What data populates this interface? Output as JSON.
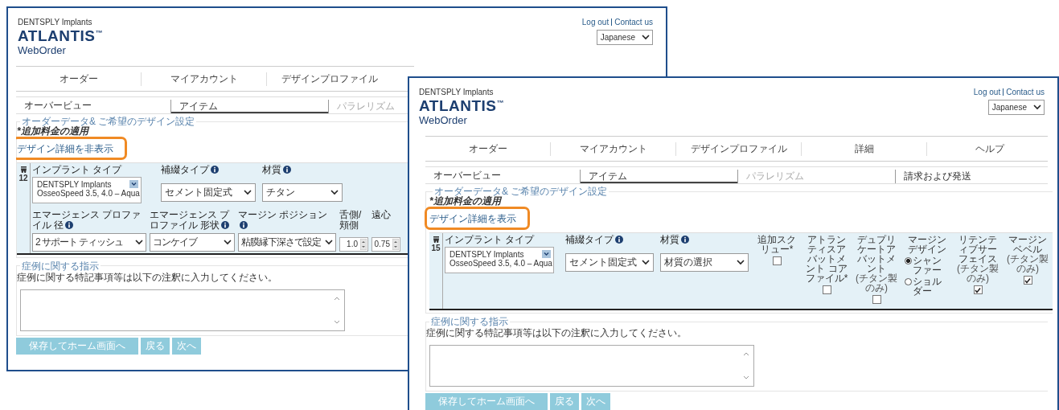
{
  "windows": [
    {
      "brand": {
        "company": "DENTSPLY Implants",
        "logo": "ATLANTIS$^{™}$",
        "product": "WebOrder"
      },
      "header_links": [
        {
          "label": "Log out"
        },
        {
          "label": "Contact us"
        }
      ],
      "language_select": {
        "value": "Japanese"
      },
      "nav": [
        {
          "label": "オーダー"
        },
        {
          "label": "マイアカウント"
        },
        {
          "label": "デザインプロファイル"
        }
      ],
      "subtabs": [
        {
          "label": "オーバービュー",
          "selected": false,
          "disabled": false
        },
        {
          "label": "アイテム",
          "selected": true,
          "disabled": false
        },
        {
          "label": "パラレリズム",
          "selected": false,
          "disabled": true
        }
      ],
      "design": {
        "legend": "オーダーデータ& ご希望のデザイン設定",
        "note": "*追加料金の適用",
        "toggle": {
          "label": "デザイン詳細を非表示",
          "highlighted": true
        },
        "tooth": "12",
        "rows": [
          {
            "fields": [
              {
                "kind": "implant",
                "label": "インプラント タイプ",
                "info": false,
                "value": [
                  "DENTSPLY Implants",
                  "OsseoSpeed 3.5, 4.0 – Aqua"
                ]
              },
              {
                "kind": "select",
                "label": "補綴タイプ",
                "info": true,
                "value": "セメント固定式"
              },
              {
                "kind": "select",
                "label": "材質",
                "info": true,
                "value": "チタン"
              }
            ]
          },
          {
            "fields": [
              {
                "kind": "select",
                "label": "エマージェンス プロファイル 径",
                "info": true,
                "value": "2 サポート ティッシュ"
              },
              {
                "kind": "select",
                "label": "エマージェンス プロファイル 形状",
                "info": true,
                "value": "コンケイブ"
              },
              {
                "kind": "select",
                "label": "マージン ポジション",
                "info": true,
                "value": "粘膜縁下深さで設定"
              },
              {
                "kind": "spinner",
                "label": "舌側/頬側",
                "info": false,
                "value": "1.0"
              },
              {
                "kind": "spinner",
                "label": "遠心",
                "info": false,
                "value": "0.75"
              }
            ]
          }
        ]
      },
      "instructions": {
        "legend": "症例に関する指示",
        "text": "症例に関する特記事項等は以下の注釈に入力してください。"
      },
      "buttons": [
        {
          "label": "保存してホーム画面へ"
        },
        {
          "label": "戻る"
        },
        {
          "label": "次へ"
        }
      ]
    },
    {
      "brand": {
        "company": "DENTSPLY Implants",
        "logo": "ATLANTIS$^{™}$",
        "product": "WebOrder"
      },
      "header_links": [
        {
          "label": "Log out"
        },
        {
          "label": "Contact us"
        }
      ],
      "language_select": {
        "value": "Japanese"
      },
      "nav": [
        {
          "label": "オーダー"
        },
        {
          "label": "マイアカウント"
        },
        {
          "label": "デザインプロファイル"
        },
        {
          "label": "詳細"
        },
        {
          "label": "ヘルプ"
        }
      ],
      "subtabs": [
        {
          "label": "オーバービュー",
          "selected": false,
          "disabled": false
        },
        {
          "label": "アイテム",
          "selected": true,
          "disabled": false
        },
        {
          "label": "パラレリズム",
          "selected": false,
          "disabled": true
        },
        {
          "label": "請求および発送",
          "selected": false,
          "disabled": false
        }
      ],
      "design": {
        "legend": "オーダーデータ& ご希望のデザイン設定",
        "note": "*追加料金の適用",
        "toggle": {
          "label": "デザイン詳細を表示",
          "highlighted": true
        },
        "tooth": "15",
        "rows": [
          {
            "fields": [
              {
                "kind": "implant",
                "label": "インプラント タイプ",
                "info": false,
                "value": [
                  "DENTSPLY Implants",
                  "OsseoSpeed 3.5, 4.0 – Aqua"
                ]
              },
              {
                "kind": "select",
                "label": "補綴タイプ",
                "info": true,
                "value": "セメント固定式"
              },
              {
                "kind": "select",
                "label": "材質",
                "info": true,
                "value": "材質の選択"
              },
              {
                "kind": "checkbox",
                "label": "追加スクリュー*",
                "checked": false
              },
              {
                "kind": "checkbox",
                "label": "アトランティスアバットメント コアファイル*",
                "checked": false
              },
              {
                "kind": "checkbox",
                "label": "デュプリケートアバットメント",
                "sublabel": "(チタン製のみ)",
                "checked": false
              },
              {
                "kind": "radio",
                "label": "マージンデザイン",
                "choices": [
                  {
                    "label": "シャンファー",
                    "selected": true
                  },
                  {
                    "label": "ショルダー",
                    "selected": false
                  }
                ]
              },
              {
                "kind": "checkbox",
                "label": "リテンティブサーフェイス",
                "sublabel": "(チタン製のみ)",
                "checked": true
              },
              {
                "kind": "checkbox",
                "label": "マージンベベル",
                "sublabel": "(チタン製のみ)",
                "checked": true
              }
            ]
          }
        ]
      },
      "instructions": {
        "legend": "症例に関する指示",
        "text": "症例に関する特記事項等は以下の注釈に入力してください。"
      },
      "buttons": [
        {
          "label": "保存してホーム画面へ"
        },
        {
          "label": "戻る"
        },
        {
          "label": "次へ"
        }
      ]
    }
  ]
}
